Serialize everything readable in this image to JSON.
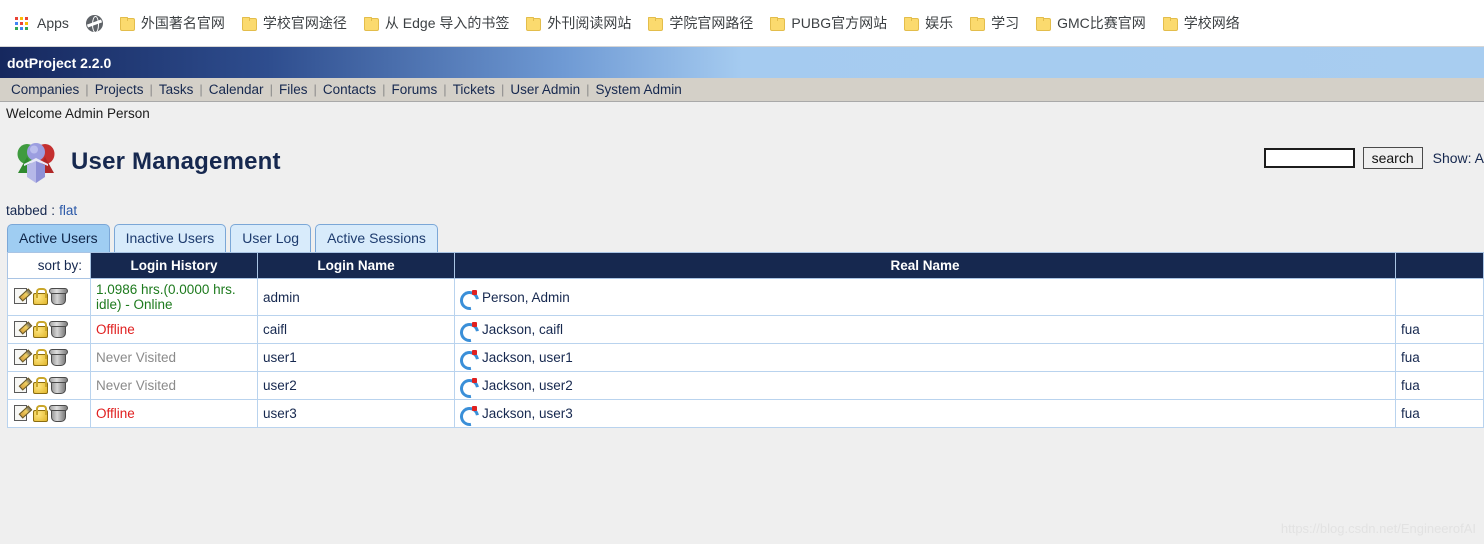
{
  "browser": {
    "apps_label": "Apps",
    "apps_icon": "grid-apps-icon",
    "globe_icon": "globe-icon",
    "bookmarks": [
      {
        "label": "外国著名官网",
        "icon": "folder-icon"
      },
      {
        "label": "学校官网途径",
        "icon": "folder-icon"
      },
      {
        "label": "从 Edge 导入的书签",
        "icon": "folder-icon"
      },
      {
        "label": "外刊阅读网站",
        "icon": "folder-icon"
      },
      {
        "label": "学院官网路径",
        "icon": "folder-icon"
      },
      {
        "label": "PUBG官方网站",
        "icon": "folder-icon"
      },
      {
        "label": "娱乐",
        "icon": "folder-icon"
      },
      {
        "label": "学习",
        "icon": "folder-icon"
      },
      {
        "label": "GMC比赛官网",
        "icon": "folder-icon"
      },
      {
        "label": "学校网络",
        "icon": "folder-icon"
      }
    ]
  },
  "app": {
    "title": "dotProject 2.2.0",
    "header_gradient_from": "#16285e",
    "header_gradient_to": "#a8cdf0",
    "nav": [
      "Companies",
      "Projects",
      "Tasks",
      "Calendar",
      "Files",
      "Contacts",
      "Forums",
      "Tickets",
      "User Admin",
      "System Admin"
    ],
    "welcome": "Welcome Admin Person"
  },
  "page": {
    "title": "User Management",
    "title_icon": "users-group-icon",
    "title_color": "#16284f"
  },
  "search": {
    "value": "",
    "placeholder": "",
    "button_label": "search",
    "show_label": "Show: A"
  },
  "view_switch": {
    "current": "tabbed",
    "separator": ":",
    "alternate": "flat"
  },
  "tabs": [
    {
      "label": "Active Users",
      "active": true
    },
    {
      "label": "Inactive Users",
      "active": false
    },
    {
      "label": "User Log",
      "active": false
    },
    {
      "label": "Active Sessions",
      "active": false
    }
  ],
  "table": {
    "sort_by_label": "sort by:",
    "columns": [
      "Login History",
      "Login Name",
      "Real Name",
      ""
    ],
    "rows": [
      {
        "actions": [
          "edit-icon",
          "lock-icon",
          "trash-icon"
        ],
        "history": "1.0986 hrs.(0.0000 hrs. idle) - Online",
        "history_status": "online",
        "login": "admin",
        "realname": "Person, Admin",
        "realname_icon": "sync-icon",
        "extra": ""
      },
      {
        "actions": [
          "edit-icon",
          "lock-icon",
          "trash-icon"
        ],
        "history": "Offline",
        "history_status": "offline",
        "login": "caifl",
        "realname": "Jackson, caifl",
        "realname_icon": "sync-icon",
        "extra": "fua"
      },
      {
        "actions": [
          "edit-icon",
          "lock-icon",
          "trash-icon"
        ],
        "history": "Never Visited",
        "history_status": "never",
        "login": "user1",
        "realname": "Jackson, user1",
        "realname_icon": "sync-icon",
        "extra": "fua"
      },
      {
        "actions": [
          "edit-icon",
          "lock-icon",
          "trash-icon"
        ],
        "history": "Never Visited",
        "history_status": "never",
        "login": "user2",
        "realname": "Jackson, user2",
        "realname_icon": "sync-icon",
        "extra": "fua"
      },
      {
        "actions": [
          "edit-icon",
          "lock-icon",
          "trash-icon"
        ],
        "history": "Offline",
        "history_status": "offline",
        "login": "user3",
        "realname": "Jackson, user3",
        "realname_icon": "sync-icon",
        "extra": "fua"
      }
    ]
  },
  "watermark": "https://blog.csdn.net/EngineerofAI"
}
